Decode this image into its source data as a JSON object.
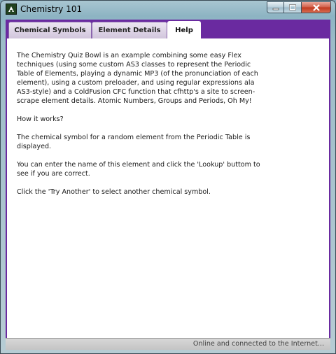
{
  "window": {
    "title": "Chemistry 101",
    "icon": "app-icon",
    "controls": [
      "minimize-icon",
      "maximize-icon",
      "close-icon"
    ]
  },
  "tabs": [
    {
      "label": "Chemical Symbols",
      "active": false
    },
    {
      "label": "Element Details",
      "active": false
    },
    {
      "label": "Help",
      "active": true
    }
  ],
  "help": {
    "paragraphs": [
      "The Chemistry Quiz Bowl is an example combining some easy Flex techniques (using some custom AS3 classes to represent the Periodic Table of Elements, playing a dynamic MP3 (of the pronunciation of each element), using a custom preloader, and using regular expressions ala AS3-style) and a ColdFusion CFC function that cfhttp's a site to screen-scrape element details. Atomic Numbers, Groups and Periods, Oh My!",
      "How it works?",
      "The chemical symbol for a random element from the Periodic Table is displayed.",
      "You can enter the name of this element and click the 'Lookup' buttom to see if you are correct.",
      "Click the 'Try Another' to select another chemical symbol."
    ]
  },
  "status": {
    "text": "Online and connected to the Internet..."
  },
  "colors": {
    "accent": "#6a2aa0",
    "tab_inactive": "#d8cde2",
    "content_bg": "#ffffff"
  }
}
